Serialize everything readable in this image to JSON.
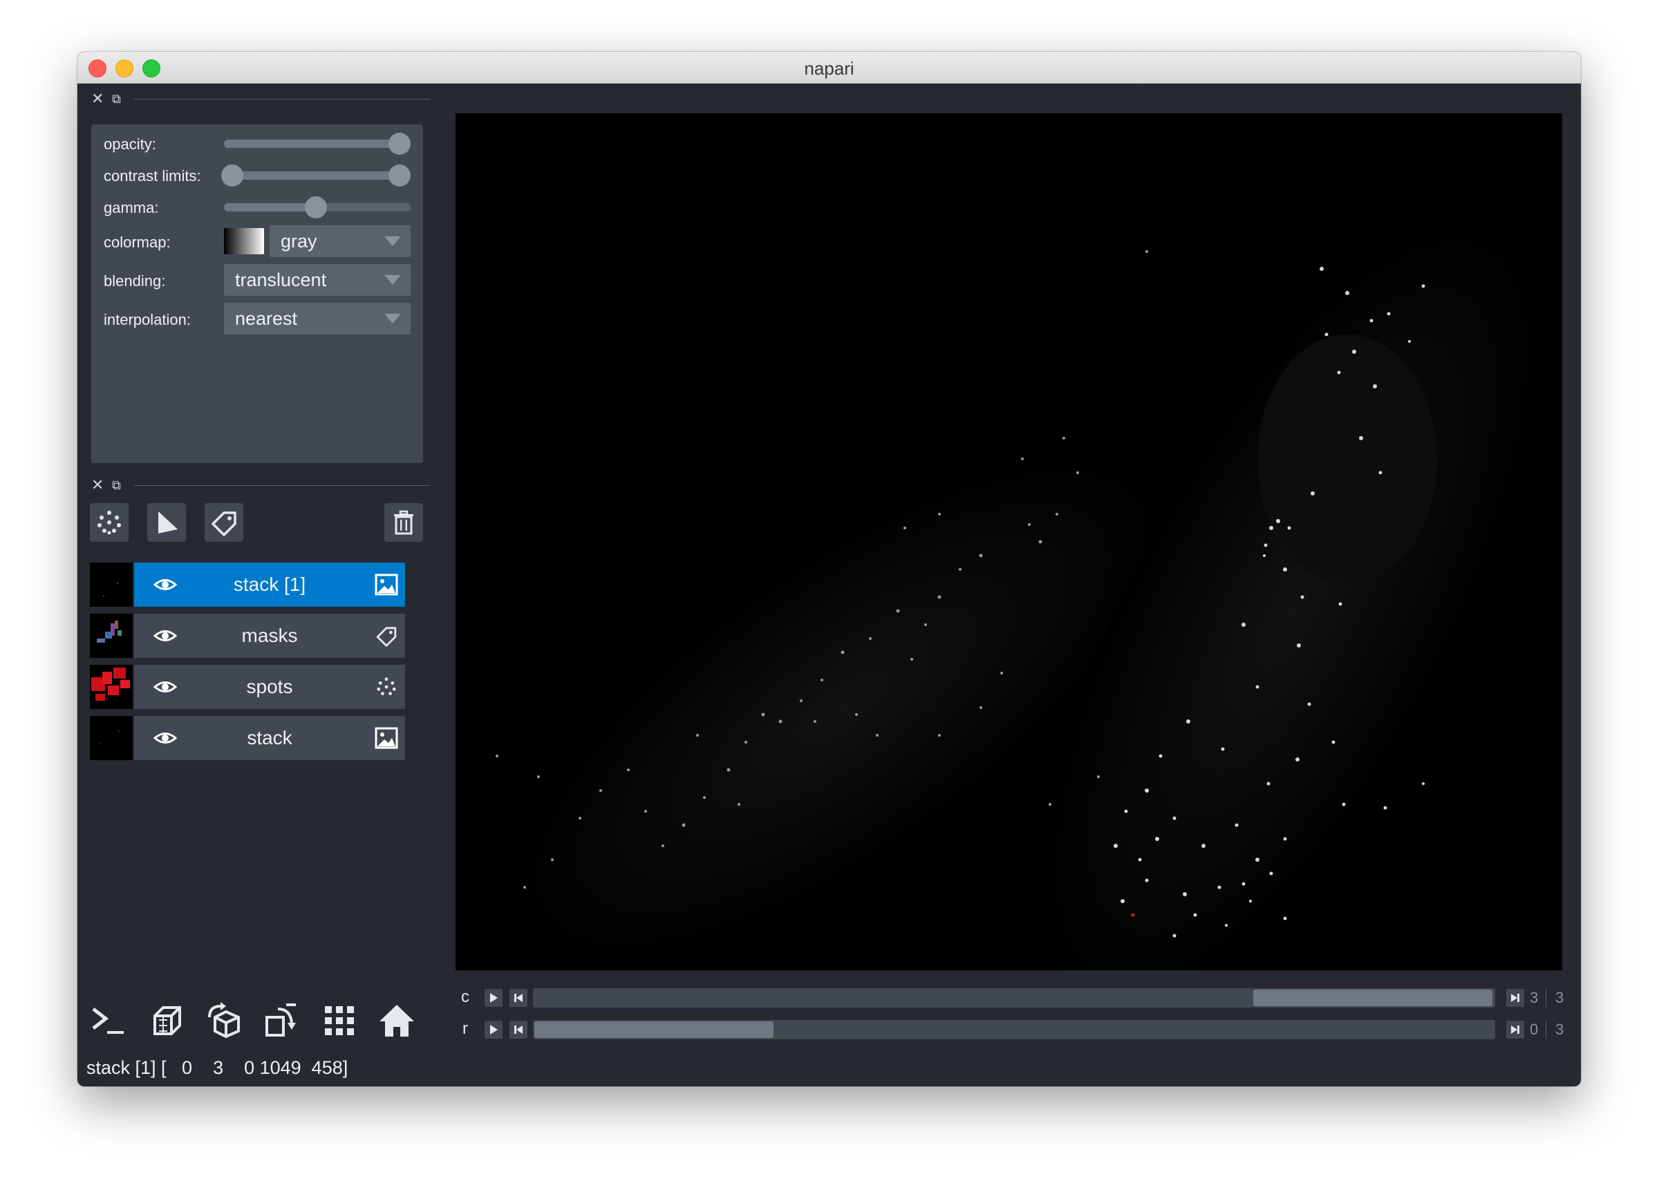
{
  "window": {
    "title": "napari"
  },
  "layer_controls": {
    "opacity_label": "opacity:",
    "opacity_value": 1.0,
    "contrast_label": "contrast limits:",
    "contrast_range": [
      0.0,
      1.0
    ],
    "gamma_label": "gamma:",
    "gamma_value": 0.5,
    "colormap_label": "colormap:",
    "colormap_value": "gray",
    "blending_label": "blending:",
    "blending_value": "translucent",
    "interpolation_label": "interpolation:",
    "interpolation_value": "nearest"
  },
  "layer_toolbar": {
    "new_points_icon": "points-icon",
    "new_shapes_icon": "shapes-icon",
    "new_labels_icon": "labels-icon",
    "delete_icon": "trash-icon"
  },
  "layers": [
    {
      "name": "stack [1]",
      "type_icon": "image-icon",
      "selected": true
    },
    {
      "name": "masks",
      "type_icon": "labels-icon",
      "selected": false
    },
    {
      "name": "spots",
      "type_icon": "points-icon",
      "selected": false
    },
    {
      "name": "stack",
      "type_icon": "image-icon",
      "selected": false
    }
  ],
  "bottom_buttons": [
    "console-icon",
    "ndisplay-icon",
    "roll-icon",
    "transpose-icon",
    "grid-icon",
    "home-icon"
  ],
  "status": {
    "text": "stack [1] [   0    3    0 1049  458]"
  },
  "dims": [
    {
      "label": "c",
      "value": "3",
      "max": "3",
      "fraction": 0.75
    },
    {
      "label": "r",
      "value": "0",
      "max": "3",
      "fraction": 0.0
    }
  ],
  "colors": {
    "accent": "#007acc",
    "panel": "#414851",
    "background": "#262930"
  }
}
